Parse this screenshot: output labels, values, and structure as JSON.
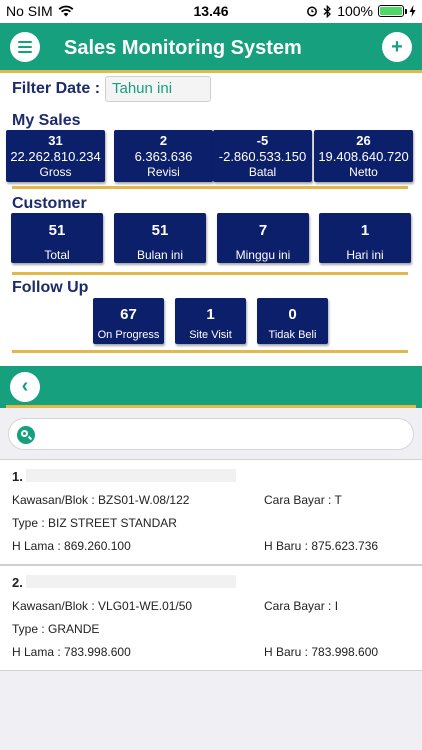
{
  "status_bar": {
    "carrier": "No SIM",
    "time": "13.46",
    "battery": "100%"
  },
  "header": {
    "title": "Sales Monitoring System"
  },
  "filter": {
    "label": "Filter Date :",
    "value": "Tahun ini"
  },
  "my_sales": {
    "title": "My Sales",
    "cards": [
      {
        "count": "31",
        "amount": "22.262.810.234",
        "label": "Gross"
      },
      {
        "count": "2",
        "amount": "6.363.636",
        "label": "Revisi"
      },
      {
        "count": "-5",
        "amount": "-2.860.533.150",
        "label": "Batal"
      },
      {
        "count": "26",
        "amount": "19.408.640.720",
        "label": "Netto"
      }
    ]
  },
  "customer": {
    "title": "Customer",
    "cards": [
      {
        "count": "51",
        "label": "Total"
      },
      {
        "count": "51",
        "label": "Bulan ini"
      },
      {
        "count": "7",
        "label": "Minggu ini"
      },
      {
        "count": "1",
        "label": "Hari ini"
      }
    ]
  },
  "follow_up": {
    "title": "Follow Up",
    "cards": [
      {
        "count": "67",
        "label": "On Progress"
      },
      {
        "count": "1",
        "label": "Site Visit"
      },
      {
        "count": "0",
        "label": "Tidak Beli"
      }
    ]
  },
  "list": {
    "items": [
      {
        "number": "1.",
        "kawasan": "Kawasan/Blok : BZS01-W.08/122",
        "cara_bayar": "Cara Bayar : T",
        "type": "Type : BIZ STREET STANDAR",
        "h_lama": "H Lama : 869.260.100",
        "h_baru": "H Baru : 875.623.736"
      },
      {
        "number": "2.",
        "kawasan": "Kawasan/Blok : VLG01-WE.01/50",
        "cara_bayar": "Cara Bayar : I",
        "type": "Type : GRANDE",
        "h_lama": "H Lama : 783.998.600",
        "h_baru": "H Baru : 783.998.600"
      }
    ]
  },
  "colors": {
    "primary": "#17a07d",
    "card": "#0c1f6b",
    "accent_line": "#e2b84a",
    "heading": "#1b2b6b"
  }
}
